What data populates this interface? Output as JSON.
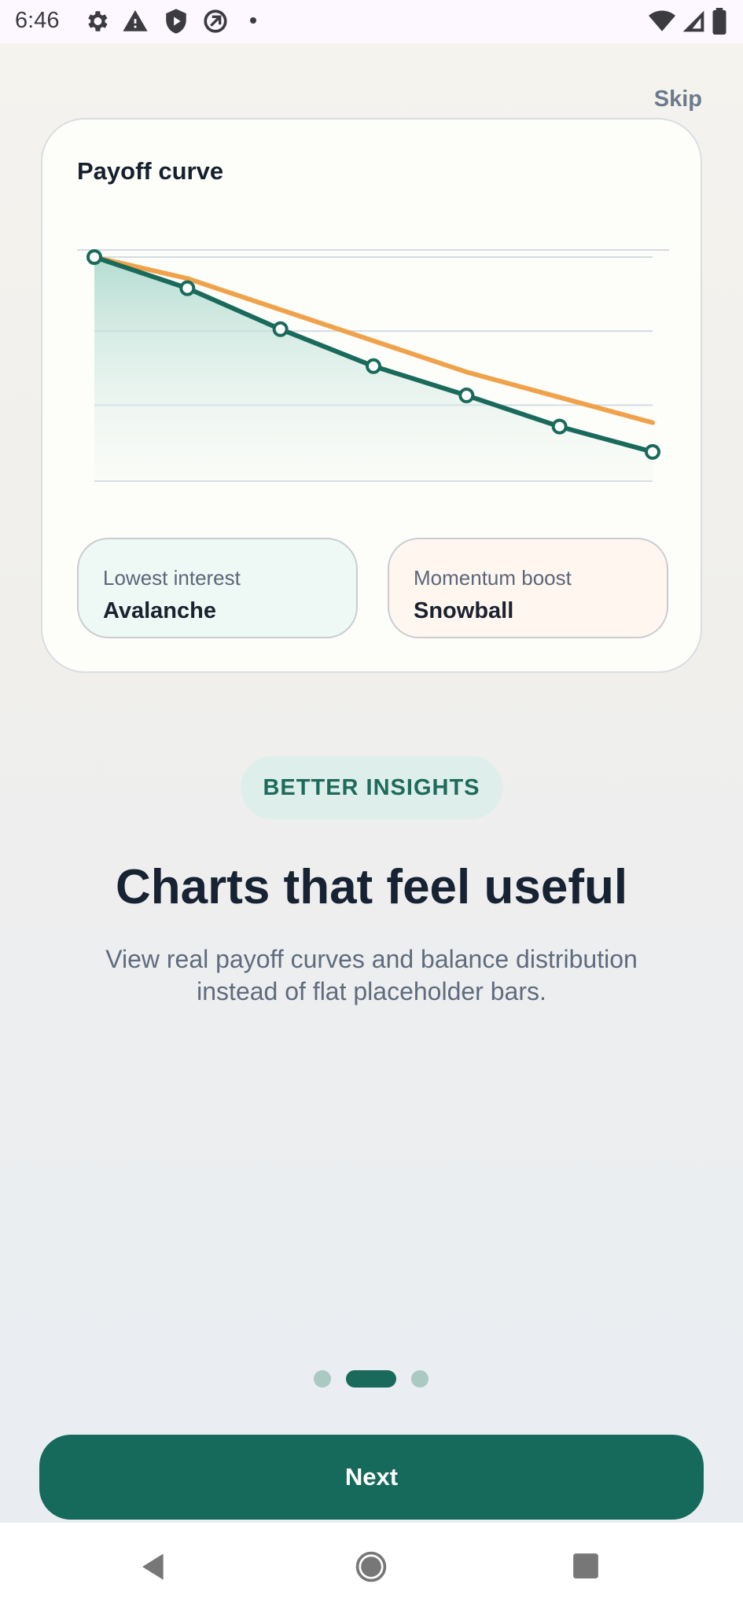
{
  "status_bar": {
    "time": "6:46",
    "icons_left": [
      "settings-icon",
      "warning-icon",
      "shield-icon",
      "sync-off-icon",
      "dot-icon"
    ],
    "icons_right": [
      "wifi-icon",
      "signal-icon",
      "battery-icon"
    ]
  },
  "header": {
    "skip_label": "Skip"
  },
  "card": {
    "title": "Payoff curve",
    "chart_data": {
      "type": "line",
      "x": [
        0,
        1,
        2,
        3,
        4,
        5,
        6
      ],
      "series": [
        {
          "values": [
            100,
            84,
            63,
            44,
            29,
            13,
            0
          ],
          "color": "#1a6a5b",
          "fill": "area",
          "markers": true
        },
        {
          "values": [
            100,
            89,
            73,
            57,
            41,
            28,
            15
          ],
          "color": "#efa24a",
          "markers": false
        }
      ],
      "ylim": [
        -15,
        100
      ],
      "grid": true,
      "xlabel": "",
      "ylabel": ""
    },
    "stats": [
      {
        "label": "Lowest interest",
        "value": "Avalanche"
      },
      {
        "label": "Momentum boost",
        "value": "Snowball"
      }
    ]
  },
  "badge": "BETTER INSIGHTS",
  "headline": "Charts that feel useful",
  "subtext": "View real payoff curves and balance distribution instead of flat placeholder bars.",
  "pagination": {
    "total": 3,
    "current": 1
  },
  "next_button": "Next",
  "nav_bar": [
    "back-icon",
    "home-icon",
    "recents-icon"
  ],
  "colors": {
    "accent": "#166a5b",
    "secondary": "#efa24a",
    "badge_bg": "#deefeb"
  }
}
